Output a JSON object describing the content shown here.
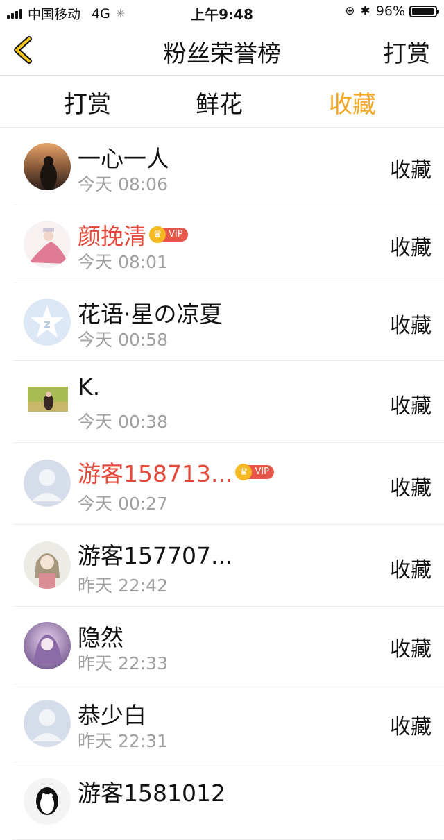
{
  "status_bar": {
    "carrier": "中国移动",
    "network": "4G",
    "time": "上午9:48",
    "battery": "96%",
    "battery_level": 0.96
  },
  "nav": {
    "back_icon": "chevron-left-icon",
    "title": "粉丝荣誉榜",
    "action": "打赏",
    "accent": "#f5a623"
  },
  "tabs": [
    {
      "label": "打赏",
      "active": false
    },
    {
      "label": "鲜花",
      "active": false
    },
    {
      "label": "收藏",
      "active": true
    }
  ],
  "vip_label": "VIP",
  "vip_color": "#e34a3c",
  "rows": [
    {
      "name": "一心一人",
      "time": "今天 08:06",
      "action": "收藏",
      "vip": false
    },
    {
      "name": "颜挽清",
      "time": "今天 08:01",
      "action": "收藏",
      "vip": true
    },
    {
      "name": "花语·星の凉夏",
      "time": "今天 00:58",
      "action": "收藏",
      "vip": false
    },
    {
      "name": "K.",
      "time": "今天 00:38",
      "action": "收藏",
      "vip": false
    },
    {
      "name": "游客158713...",
      "time": "今天 00:27",
      "action": "收藏",
      "vip": true
    },
    {
      "name": "游客157707...",
      "time": "昨天 22:42",
      "action": "收藏",
      "vip": false
    },
    {
      "name": "隐然",
      "time": "昨天 22:33",
      "action": "收藏",
      "vip": false
    },
    {
      "name": "恭少白",
      "time": "昨天 22:31",
      "action": "收藏",
      "vip": false
    },
    {
      "name": "游客1581012",
      "time": "",
      "action": "",
      "vip": false
    }
  ]
}
